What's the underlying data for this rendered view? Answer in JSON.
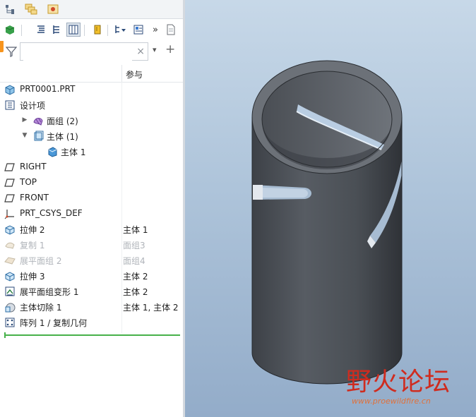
{
  "tabs": [
    {
      "name": "model-tree-tab",
      "icon": "model-tree-icon"
    },
    {
      "name": "layers-tab",
      "icon": "layers-icon"
    },
    {
      "name": "favorites-tab",
      "icon": "favorites-icon"
    }
  ],
  "toolbar": {
    "overflow_label": "»"
  },
  "search": {
    "value": "",
    "clear_label": "×",
    "add_label": "+",
    "dropdown_label": "▾"
  },
  "columns": {
    "name_header": "",
    "ref_header": "参与"
  },
  "tree": [
    {
      "label": "PRT0001.PRT",
      "ref": "",
      "level": 0,
      "expander": "",
      "icon": "part-icon",
      "dim": false
    },
    {
      "label": "设计项",
      "ref": "",
      "level": 0,
      "expander": "▼",
      "icon": "design-items-icon",
      "dim": false
    },
    {
      "label": "面组 (2)",
      "ref": "",
      "level": 1,
      "expander": "▶",
      "icon": "quilt-icon",
      "dim": false
    },
    {
      "label": "主体 (1)",
      "ref": "",
      "level": 1,
      "expander": "▼",
      "icon": "body-group-icon",
      "dim": false
    },
    {
      "label": "主体 1",
      "ref": "",
      "level": 2,
      "expander": "",
      "icon": "body-icon",
      "dim": false
    },
    {
      "label": "RIGHT",
      "ref": "",
      "level": 0,
      "expander": "",
      "icon": "datum-plane-icon",
      "dim": false
    },
    {
      "label": "TOP",
      "ref": "",
      "level": 0,
      "expander": "",
      "icon": "datum-plane-icon",
      "dim": false
    },
    {
      "label": "FRONT",
      "ref": "",
      "level": 0,
      "expander": "",
      "icon": "datum-plane-icon",
      "dim": false
    },
    {
      "label": "PRT_CSYS_DEF",
      "ref": "",
      "level": 0,
      "expander": "",
      "icon": "csys-icon",
      "dim": false
    },
    {
      "label": "拉伸 2",
      "ref": "主体 1",
      "level": 0,
      "expander": "▶",
      "icon": "extrude-icon",
      "dim": false
    },
    {
      "label": "复制 1",
      "ref": "面组3",
      "level": 0,
      "expander": "",
      "icon": "copy-icon",
      "dim": true
    },
    {
      "label": "展平面组 2",
      "ref": "面组4",
      "level": 0,
      "expander": "",
      "icon": "flatten-quilt-icon",
      "dim": true
    },
    {
      "label": "拉伸 3",
      "ref": "主体 2",
      "level": 0,
      "expander": "▶",
      "icon": "extrude-icon",
      "dim": false
    },
    {
      "label": "展平面组变形 1",
      "ref": "主体 2",
      "level": 0,
      "expander": "",
      "icon": "flatten-deform-icon",
      "dim": false
    },
    {
      "label": "主体切除 1",
      "ref": "主体 1, 主体 2",
      "level": 0,
      "expander": "",
      "icon": "body-cut-icon",
      "dim": false
    },
    {
      "label": "阵列 1 / 复制几何",
      "ref": "",
      "level": 0,
      "expander": "▶",
      "icon": "pattern-icon",
      "dim": false
    }
  ],
  "watermark": {
    "title": "野火论坛",
    "url": "www.proewildfire.cn"
  },
  "colors": {
    "accent": "#f7941d",
    "insert_line": "#47b14a",
    "model": "#4c5258"
  }
}
